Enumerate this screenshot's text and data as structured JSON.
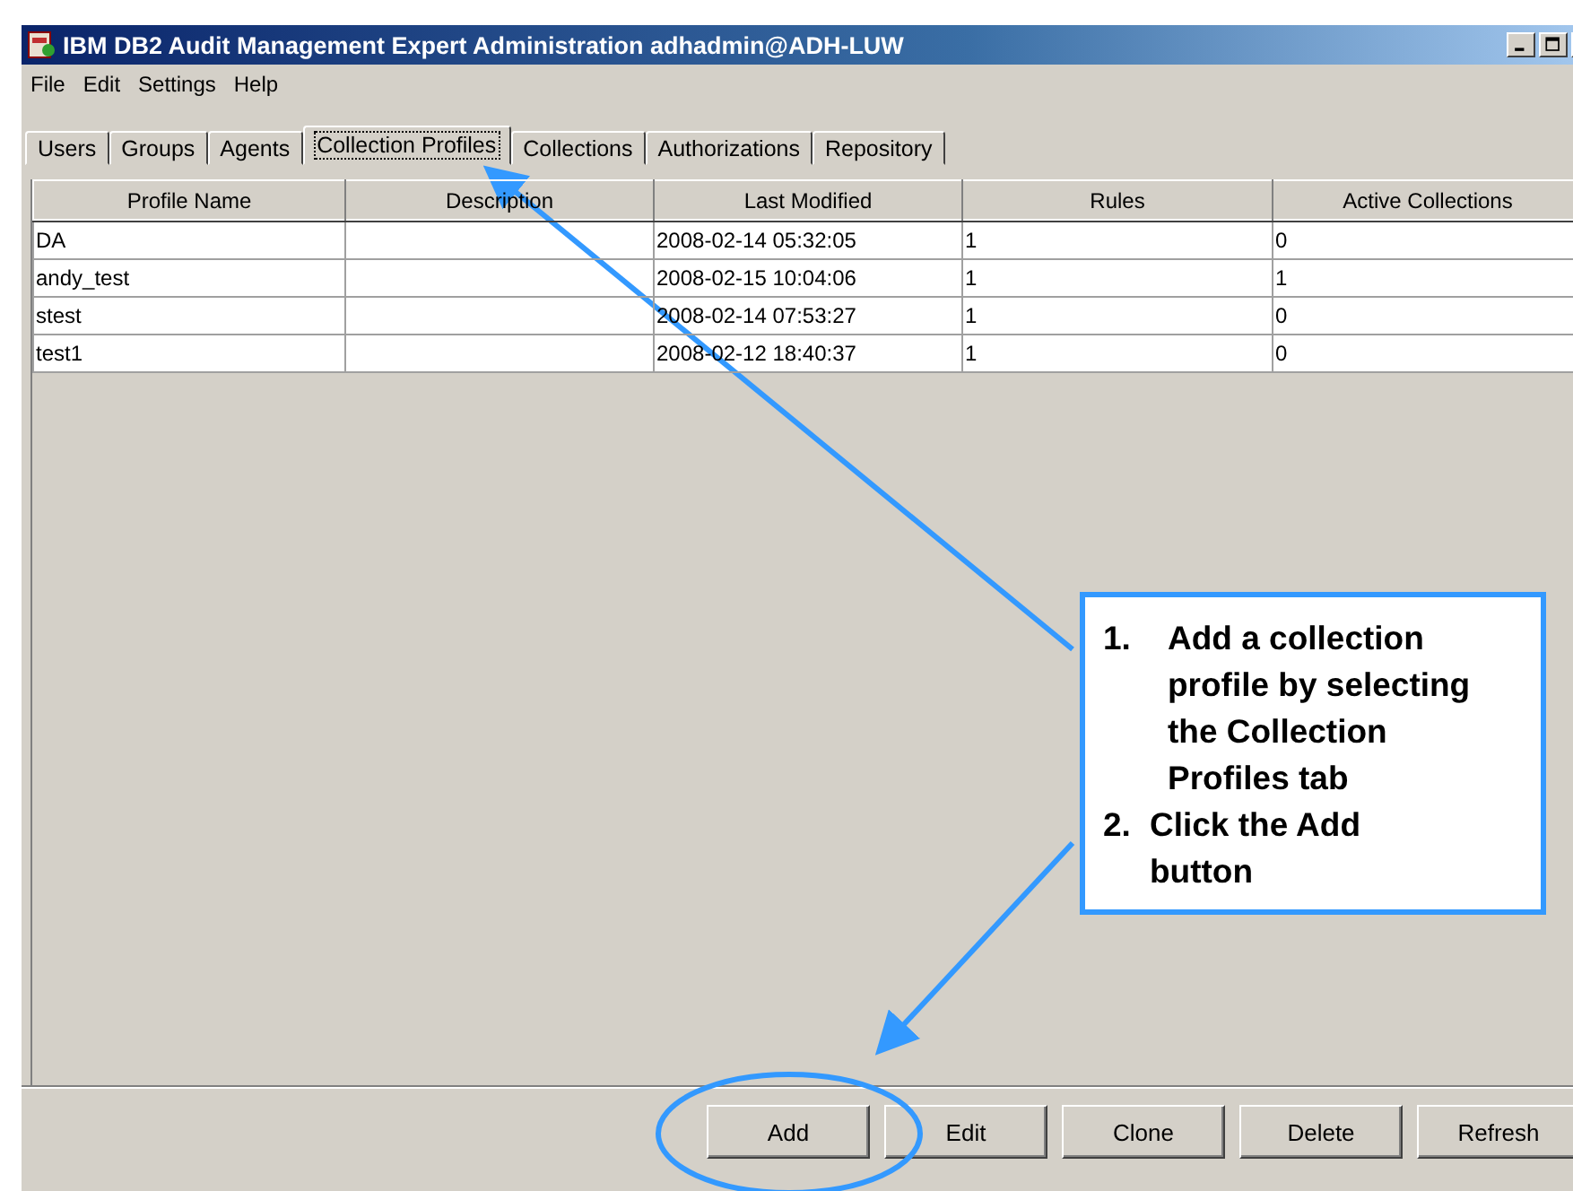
{
  "window": {
    "title": "IBM DB2 Audit Management Expert Administration adhadmin@ADH-LUW"
  },
  "menu": [
    "File",
    "Edit",
    "Settings",
    "Help"
  ],
  "tabs": [
    {
      "label": "Users",
      "selected": false
    },
    {
      "label": "Groups",
      "selected": false
    },
    {
      "label": "Agents",
      "selected": false
    },
    {
      "label": "Collection Profiles",
      "selected": true
    },
    {
      "label": "Collections",
      "selected": false
    },
    {
      "label": "Authorizations",
      "selected": false
    },
    {
      "label": "Repository",
      "selected": false
    }
  ],
  "table": {
    "columns": [
      "Profile Name",
      "Description",
      "Last Modified",
      "Rules",
      "Active Collections"
    ],
    "rows": [
      [
        "DA",
        "",
        "2008-02-14 05:32:05",
        "1",
        "0"
      ],
      [
        "andy_test",
        "",
        "2008-02-15 10:04:06",
        "1",
        "1"
      ],
      [
        "stest",
        "",
        "2008-02-14 07:53:27",
        "1",
        "0"
      ],
      [
        "test1",
        "",
        "2008-02-12 18:40:37",
        "1",
        "0"
      ]
    ]
  },
  "buttons": [
    "Add",
    "Edit",
    "Clone",
    "Delete",
    "Refresh"
  ],
  "callout": {
    "items": [
      {
        "number": "1.",
        "text": "Add a collection profile by selecting the Collection Profiles tab"
      },
      {
        "number": "2.",
        "text": "Click the Add button"
      }
    ]
  }
}
